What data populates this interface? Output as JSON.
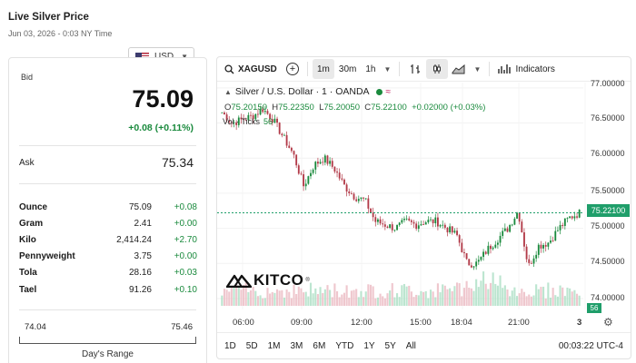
{
  "header": {
    "title": "Live Silver Price",
    "subtitle": "Jun 03, 2026 - 0:03 NY Time",
    "currency": "USD"
  },
  "quote": {
    "bid_label": "Bid",
    "bid": "75.09",
    "change": "+0.08 (+0.11%)",
    "ask_label": "Ask",
    "ask": "75.34"
  },
  "units": [
    {
      "name": "Ounce",
      "value": "75.09",
      "change": "+0.08"
    },
    {
      "name": "Gram",
      "value": "2.41",
      "change": "+0.00"
    },
    {
      "name": "Kilo",
      "value": "2,414.24",
      "change": "+2.70"
    },
    {
      "name": "Pennyweight",
      "value": "3.75",
      "change": "+0.00"
    },
    {
      "name": "Tola",
      "value": "28.16",
      "change": "+0.03"
    },
    {
      "name": "Tael",
      "value": "91.26",
      "change": "+0.10"
    }
  ],
  "days_range": {
    "low": "74.04",
    "high": "75.46",
    "label": "Day's Range"
  },
  "toolbar": {
    "symbol": "XAGUSD",
    "intervals": [
      "1m",
      "30m",
      "1h"
    ],
    "active_interval": "1m",
    "indicators_label": "Indicators"
  },
  "legend": {
    "name": "Silver / U.S. Dollar · 1 · OANDA",
    "open_k": "O",
    "open": "75.20150",
    "high_k": "H",
    "high": "75.22350",
    "low_k": "L",
    "low": "75.20050",
    "close_k": "C",
    "close": "75.22100",
    "delta": "+0.02000 (+0.03%)",
    "vol_label": "Vol · Ticks",
    "vol_value": "56"
  },
  "logo_text": "KITCO",
  "logo_reg": "®",
  "price_axis": [
    "77.00000",
    "76.50000",
    "76.00000",
    "75.50000",
    "75.00000",
    "74.50000",
    "74.00000"
  ],
  "current_price_tag": "75.22100",
  "volume_tag": "56",
  "time_axis": [
    "06:00",
    "09:00",
    "12:00",
    "15:00",
    "18:04",
    "21:00",
    "3"
  ],
  "ranges": [
    "1D",
    "5D",
    "1M",
    "3M",
    "6M",
    "YTD",
    "1Y",
    "5Y",
    "All"
  ],
  "clock": "00:03:22 UTC-4",
  "colors": {
    "up": "#1a8a3d",
    "down": "#b23a48",
    "tag": "#1f9e6a"
  },
  "icons": [
    "search-icon",
    "plus-icon",
    "chevron-down-icon",
    "bar-style-icon",
    "candle-icon",
    "area-chart-icon",
    "indicators-icon",
    "gear-icon"
  ],
  "chart_data": {
    "type": "candlestick",
    "title": "Silver / U.S. Dollar · 1 · OANDA",
    "x_ticks": [
      "06:00",
      "09:00",
      "12:00",
      "15:00",
      "18:04",
      "21:00",
      "3"
    ],
    "ylim": [
      73.87,
      77.05
    ],
    "current_price": 75.221,
    "x": [
      "05:15",
      "06:00",
      "07:00",
      "08:00",
      "08:30",
      "09:00",
      "09:30",
      "10:00",
      "10:30",
      "11:00",
      "11:30",
      "12:00",
      "12:30",
      "13:00",
      "13:30",
      "14:00",
      "14:30",
      "15:00",
      "15:30",
      "16:00",
      "16:30",
      "17:00",
      "17:30",
      "18:00",
      "18:30",
      "19:00",
      "19:30",
      "20:00",
      "20:30",
      "21:00",
      "21:30",
      "22:00",
      "22:30",
      "23:00",
      "23:30",
      "00:00"
    ],
    "close": [
      76.65,
      76.5,
      76.55,
      76.6,
      76.7,
      76.55,
      76.3,
      76.05,
      75.6,
      75.9,
      76.0,
      75.85,
      75.6,
      75.45,
      75.4,
      75.1,
      75.05,
      75.0,
      75.1,
      75.05,
      75.1,
      75.1,
      75.0,
      74.9,
      74.5,
      74.5,
      74.7,
      74.85,
      75.0,
      75.25,
      74.45,
      74.75,
      74.8,
      75.0,
      75.15,
      75.22
    ],
    "volume_note": "Vol · Ticks"
  }
}
